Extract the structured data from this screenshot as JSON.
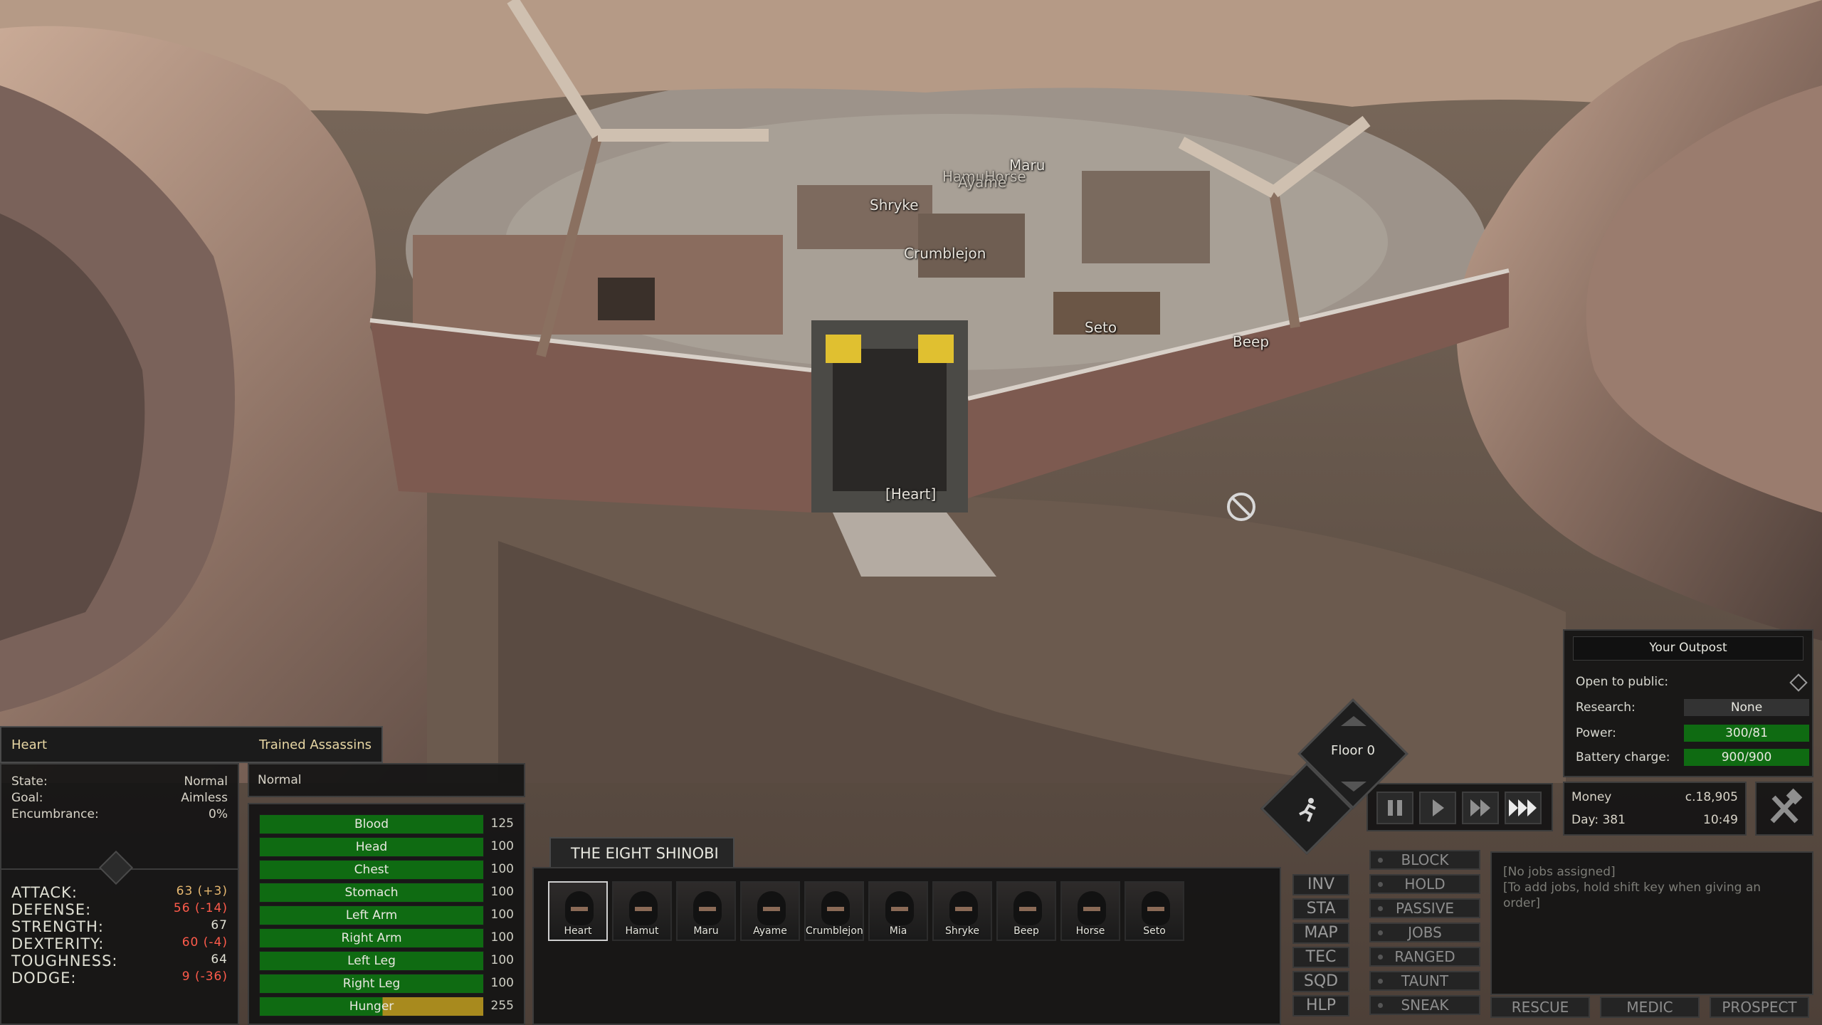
{
  "world_labels": [
    {
      "id": "maru",
      "text": "Maru"
    },
    {
      "id": "hamuthorse",
      "text": "HamuHorse"
    },
    {
      "id": "ayame",
      "text": "Ayame"
    },
    {
      "id": "shryke",
      "text": "Shryke"
    },
    {
      "id": "crumblejon",
      "text": "Crumblejon"
    },
    {
      "id": "seto",
      "text": "Seto"
    },
    {
      "id": "beep",
      "text": "Beep"
    },
    {
      "id": "heart",
      "text": "[Heart]"
    }
  ],
  "character": {
    "name": "Heart",
    "faction": "Trained Assassins",
    "state_label": "State:",
    "state": "Normal",
    "goal_label": "Goal:",
    "goal": "Aimless",
    "encumbrance_label": "Encumbrance:",
    "encumbrance": "0%",
    "attributes": [
      {
        "label": "ATTACK:",
        "value": "63 (+3)"
      },
      {
        "label": "DEFENSE:",
        "value": "56 (-14)"
      },
      {
        "label": "STRENGTH:",
        "value": "67"
      },
      {
        "label": "DEXTERITY:",
        "value": "60 (-4)"
      },
      {
        "label": "TOUGHNESS:",
        "value": "64"
      },
      {
        "label": "DODGE:",
        "value": "9 (-36)"
      }
    ],
    "status": "Normal"
  },
  "health": [
    {
      "label": "Blood",
      "value": "125",
      "fill": 1.0
    },
    {
      "label": "Head",
      "value": "100",
      "fill": 1.0
    },
    {
      "label": "Chest",
      "value": "100",
      "fill": 1.0
    },
    {
      "label": "Stomach",
      "value": "100",
      "fill": 1.0
    },
    {
      "label": "Left Arm",
      "value": "100",
      "fill": 1.0
    },
    {
      "label": "Right Arm",
      "value": "100",
      "fill": 1.0
    },
    {
      "label": "Left Leg",
      "value": "100",
      "fill": 1.0
    },
    {
      "label": "Right Leg",
      "value": "100",
      "fill": 1.0
    },
    {
      "label": "Hunger",
      "value": "255",
      "fill": 1.0
    }
  ],
  "squad": {
    "name": "THE EIGHT SHINOBI",
    "members": [
      "Heart",
      "Hamut",
      "Maru",
      "Ayame",
      "Crumblejon",
      "Mia",
      "Shryke",
      "Beep",
      "Horse",
      "Seto"
    ]
  },
  "menu_buttons": [
    "INV",
    "STA",
    "MAP",
    "TEC",
    "SQD",
    "HLP"
  ],
  "order_buttons": [
    "BLOCK",
    "HOLD",
    "PASSIVE",
    "JOBS",
    "RANGED",
    "TAUNT",
    "SNEAK"
  ],
  "bottom_buttons": [
    "RESCUE",
    "MEDIC",
    "PROSPECT"
  ],
  "jobs": {
    "line1": "[No jobs assigned]",
    "line2": "[To add jobs, hold shift key when giving an",
    "line3": "order]"
  },
  "outpost": {
    "title": "Your Outpost",
    "open_label": "Open to public:",
    "research_label": "Research:",
    "research": "None",
    "power_label": "Power:",
    "power": "300/81",
    "battery_label": "Battery charge:",
    "battery": "900/900"
  },
  "money": {
    "label": "Money",
    "value": "c.18,905",
    "day_label": "Day: 381",
    "time": "10:49"
  },
  "floor": "Floor 0",
  "colors": {
    "bar_green": "#0f6b12",
    "hunger": "#a88a1e",
    "text_red": "#ff5b4b",
    "header_gold": "#e8d7a4"
  }
}
